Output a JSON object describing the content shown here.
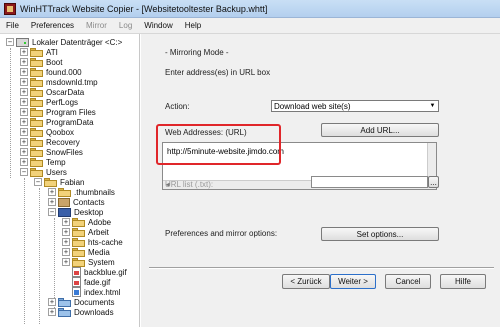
{
  "window": {
    "title": "WinHTTrack Website Copier - [Websitetooltester Backup.whtt]"
  },
  "menu": [
    "File",
    "Preferences",
    "Mirror",
    "Log",
    "Window",
    "Help"
  ],
  "menu_disabled": [
    "Mirror",
    "Log"
  ],
  "tree": {
    "root": "Lokaler Datenträger <C:>",
    "items": [
      "ATI",
      "Boot",
      "found.000",
      "msdownld.tmp",
      "OscarData",
      "PerfLogs",
      "Program Files",
      "ProgramData",
      "Qoobox",
      "Recovery",
      "SnowFiles",
      "Temp",
      "Users"
    ],
    "user": "Fabian",
    "user_items": [
      ".thumbnails",
      "Contacts",
      "Desktop"
    ],
    "desktop_items": [
      "Adobe",
      "Arbeit",
      "hts-cache",
      "Media",
      "System",
      "backblue.gif",
      "fade.gif",
      "index.html"
    ],
    "after_desktop": [
      "Documents",
      "Downloads"
    ]
  },
  "panel": {
    "mode_title": "- Mirroring Mode -",
    "instruction": "Enter address(es) in URL box",
    "action_label": "Action:",
    "action_value": "Download web site(s)",
    "web_addresses_label": "Web Addresses: (URL)",
    "add_url_button": "Add URL...",
    "url_value": "http://5minute-website.jimdo.com",
    "url_list_label": "URL list (.txt):",
    "url_list_browse": "...",
    "prefs_label": "Preferences and mirror options:",
    "set_options_button": "Set options...",
    "back_button": "< Zurück",
    "next_button": "Weiter >",
    "cancel_button": "Cancel",
    "help_button": "Hilfe"
  },
  "colors": {
    "highlight_box": "#e0262a",
    "title_bar": "#c9dff5"
  }
}
